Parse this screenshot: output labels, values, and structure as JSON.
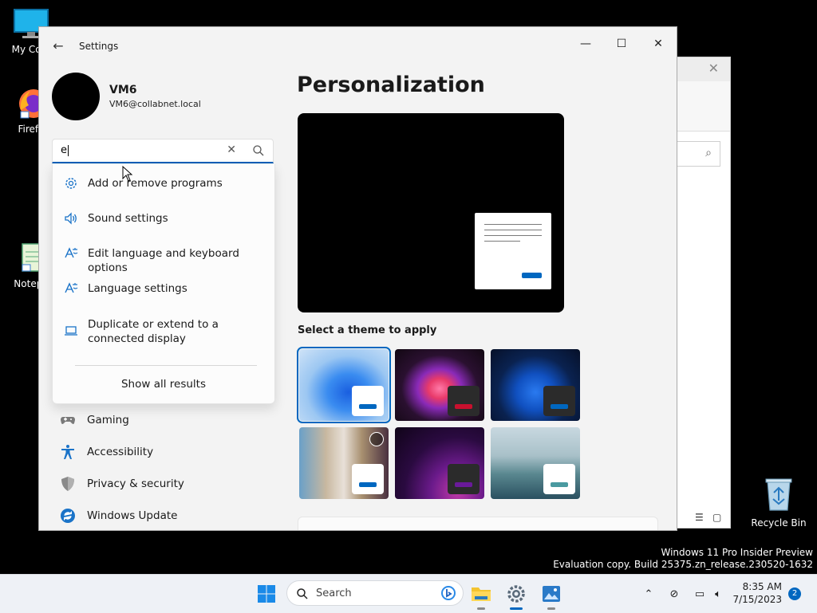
{
  "desktop": {
    "icons": [
      {
        "label": "My Com"
      },
      {
        "label": "Firefo"
      },
      {
        "label": "Notepa"
      }
    ],
    "recycle_bin": "Recycle Bin",
    "watermark": {
      "line1": "Windows 11 Pro Insider Preview",
      "line2": "Evaluation copy. Build 25375.zn_release.230520-1632"
    }
  },
  "settings": {
    "app_title": "Settings",
    "user": {
      "name": "VM6",
      "email": "VM6@collabnet.local"
    },
    "search": {
      "value": "e"
    },
    "suggestions": [
      {
        "label": "Add or remove programs",
        "icon": "gear-icon"
      },
      {
        "label": "Sound settings",
        "icon": "speaker-icon"
      },
      {
        "label": "Edit language and keyboard options",
        "icon": "language-icon"
      },
      {
        "label": "Language settings",
        "icon": "language-icon"
      },
      {
        "label": "Duplicate or extend to a connected display",
        "icon": "laptop-icon"
      }
    ],
    "show_all": "Show all results",
    "nav": [
      {
        "label": "Gaming",
        "icon": "gamepad-icon"
      },
      {
        "label": "Accessibility",
        "icon": "accessibility-icon"
      },
      {
        "label": "Privacy & security",
        "icon": "shield-icon"
      },
      {
        "label": "Windows Update",
        "icon": "update-icon"
      }
    ],
    "page_title": "Personalization",
    "theme_heading": "Select a theme to apply",
    "accent": "#0067c0"
  },
  "taskbar": {
    "search_placeholder": "Search",
    "time": "8:35 AM",
    "date": "7/15/2023",
    "notifications": "2"
  }
}
